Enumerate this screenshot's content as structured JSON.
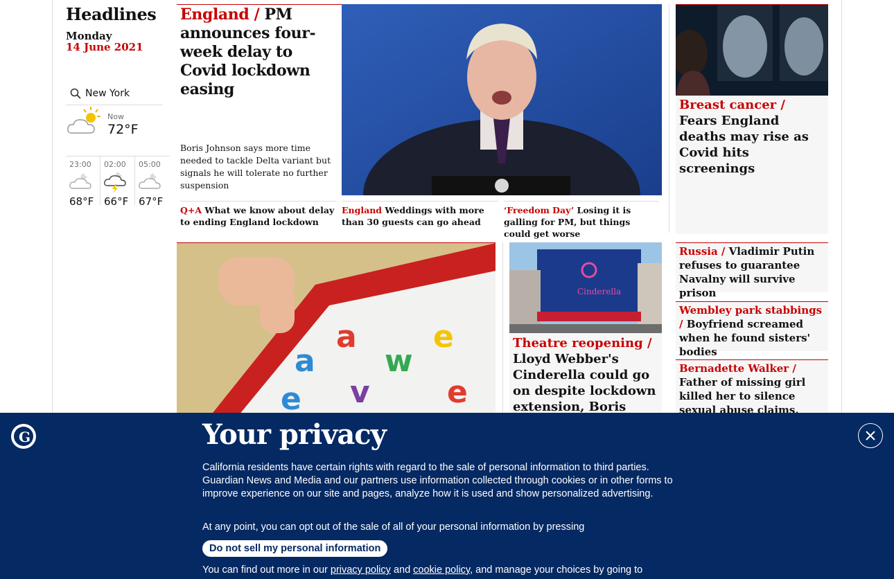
{
  "headlines": {
    "title": "Headlines",
    "day": "Monday",
    "date": "14 June 2021"
  },
  "weather": {
    "city": "New York",
    "now_label": "Now",
    "now_temp": "72°F",
    "forecast": [
      {
        "time": "23:00",
        "temp": "68°F",
        "icon": "cloudy-night-icon"
      },
      {
        "time": "02:00",
        "temp": "66°F",
        "icon": "thunderstorm-night-icon"
      },
      {
        "time": "05:00",
        "temp": "67°F",
        "icon": "cloudy-night-icon"
      }
    ]
  },
  "main_story": {
    "kicker": "England /",
    "headline": "PM announces four-week delay to Covid lockdown easing",
    "standfirst": "Boris Johnson says more time needed to tackle Delta variant but signals he will tolerate no further suspension"
  },
  "sub_links": [
    {
      "kicker": "Q+A",
      "text": "What we know about delay to ending England lockdown"
    },
    {
      "kicker": "England",
      "text": "Weddings with more than 30 guests can go ahead"
    },
    {
      "kicker": "‘Freedom Day’",
      "text": "Losing it is galling for PM, but things could get worse"
    }
  ],
  "right_story": {
    "kicker": "Breast cancer /",
    "headline": "Fears England deaths may rise as Covid hits screenings"
  },
  "theatre_story": {
    "kicker": "Theatre reopening /",
    "headline": "Lloyd Webber's Cinderella could go on despite lockdown extension, Boris"
  },
  "small_stories": [
    {
      "kicker": "Russia /",
      "headline": "Vladimir Putin refuses to guarantee Navalny will survive prison"
    },
    {
      "kicker": "Wembley park stabbings /",
      "headline": "Boyfriend screamed when he found sisters' bodies"
    },
    {
      "kicker": "Bernadette Walker /",
      "headline": "Father of missing girl killed her to silence sexual abuse claims, court told"
    }
  ],
  "privacy": {
    "title": "Your privacy",
    "text1": "California residents have certain rights with regard to the sale of personal information to third parties. Guardian News and Media and our partners use information collected through cookies or in other forms to improve experience on our site and pages, analyze how it is used and show personalized advertising.",
    "text2": "At any point, you can opt out of the sale of all of your personal information by pressing",
    "button": "Do not sell my personal information",
    "text3_pre": "You can find out more in our",
    "privacy_link": "privacy policy",
    "and": "and",
    "cookie_link": "cookie policy",
    "text3_post": ", and manage your choices by going to"
  },
  "colors": {
    "brand_red": "#c70000",
    "brand_blue": "#052962"
  }
}
